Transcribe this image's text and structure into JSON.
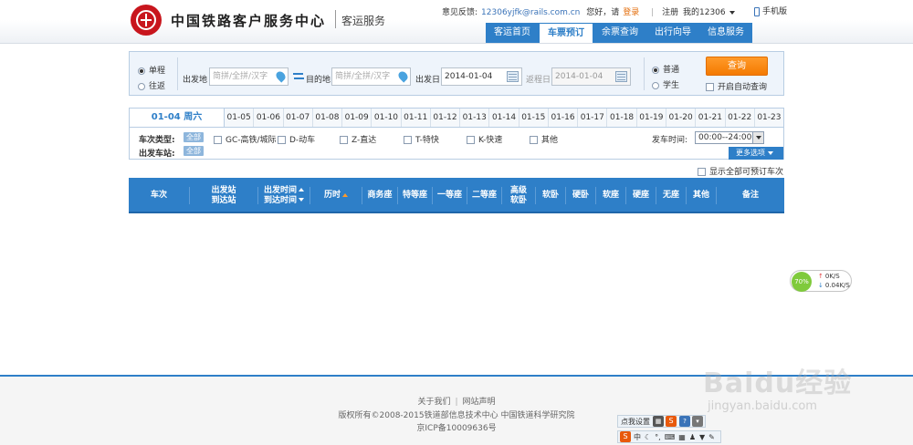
{
  "header": {
    "site_name": "中国铁路客户服务中心",
    "site_sub": "客运服务",
    "feedback_label": "意见反馈:",
    "feedback_email": "12306yjfk@rails.com.cn",
    "greeting": "您好，请",
    "login": "登录",
    "register": "注册",
    "my12306": "我的12306",
    "mobile": "手机版",
    "nav": [
      "客运首页",
      "车票预订",
      "余票查询",
      "出行向导",
      "信息服务"
    ]
  },
  "search": {
    "oneway": "单程",
    "roundtrip": "往返",
    "from_label": "出发地",
    "from_placeholder": "简拼/全拼/汉字",
    "to_label": "目的地",
    "to_placeholder": "简拼/全拼/汉字",
    "depart_label": "出发日",
    "depart_value": "2014-01-04",
    "return_label": "返程日",
    "return_value": "2014-01-04",
    "normal": "普通",
    "student": "学生",
    "query": "查询",
    "auto_query": "开启自动查询"
  },
  "dates": {
    "current": "01-04 周六",
    "tabs": [
      "01-05",
      "01-06",
      "01-07",
      "01-08",
      "01-09",
      "01-10",
      "01-11",
      "01-12",
      "01-13",
      "01-14",
      "01-15",
      "01-16",
      "01-17",
      "01-18",
      "01-19",
      "01-20",
      "01-21",
      "01-22",
      "01-23"
    ]
  },
  "filters": {
    "type_label": "车次类型:",
    "station_label": "出发车站:",
    "all": "全部",
    "types": [
      "GC-高铁/城际",
      "D-动车",
      "Z-直达",
      "T-特快",
      "K-快速",
      "其他"
    ],
    "time_label": "发车时间:",
    "time_value": "00:00--24:00",
    "more": "更多选项",
    "show_all": "显示全部可预订车次"
  },
  "table": {
    "col_train": "车次",
    "col_station_1": "出发站",
    "col_station_2": "到达站",
    "col_time_1": "出发时间",
    "col_time_2": "到达时间",
    "col_duration": "历时",
    "col_business": "商务座",
    "col_special": "特等座",
    "col_first": "一等座",
    "col_second": "二等座",
    "col_premium_1": "高级",
    "col_premium_2": "软卧",
    "col_soft_sleeper": "软卧",
    "col_hard_sleeper": "硬卧",
    "col_soft_seat": "软座",
    "col_hard_seat": "硬座",
    "col_no_seat": "无座",
    "col_other": "其他",
    "col_remark": "备注"
  },
  "speed": {
    "percent": "70%",
    "up": "0K/S",
    "down": "0.04K/S"
  },
  "footer": {
    "about": "关于我们",
    "statement": "网站声明",
    "copyright": "版权所有©2008-2015铁道部信息技术中心   中国铁道科学研究院",
    "icp": "京ICP备10009636号"
  },
  "watermark": {
    "brand": "Baidu经验",
    "url": "jingyan.baidu.com"
  },
  "ime": {
    "settings": "点我设置",
    "lang": "中"
  }
}
